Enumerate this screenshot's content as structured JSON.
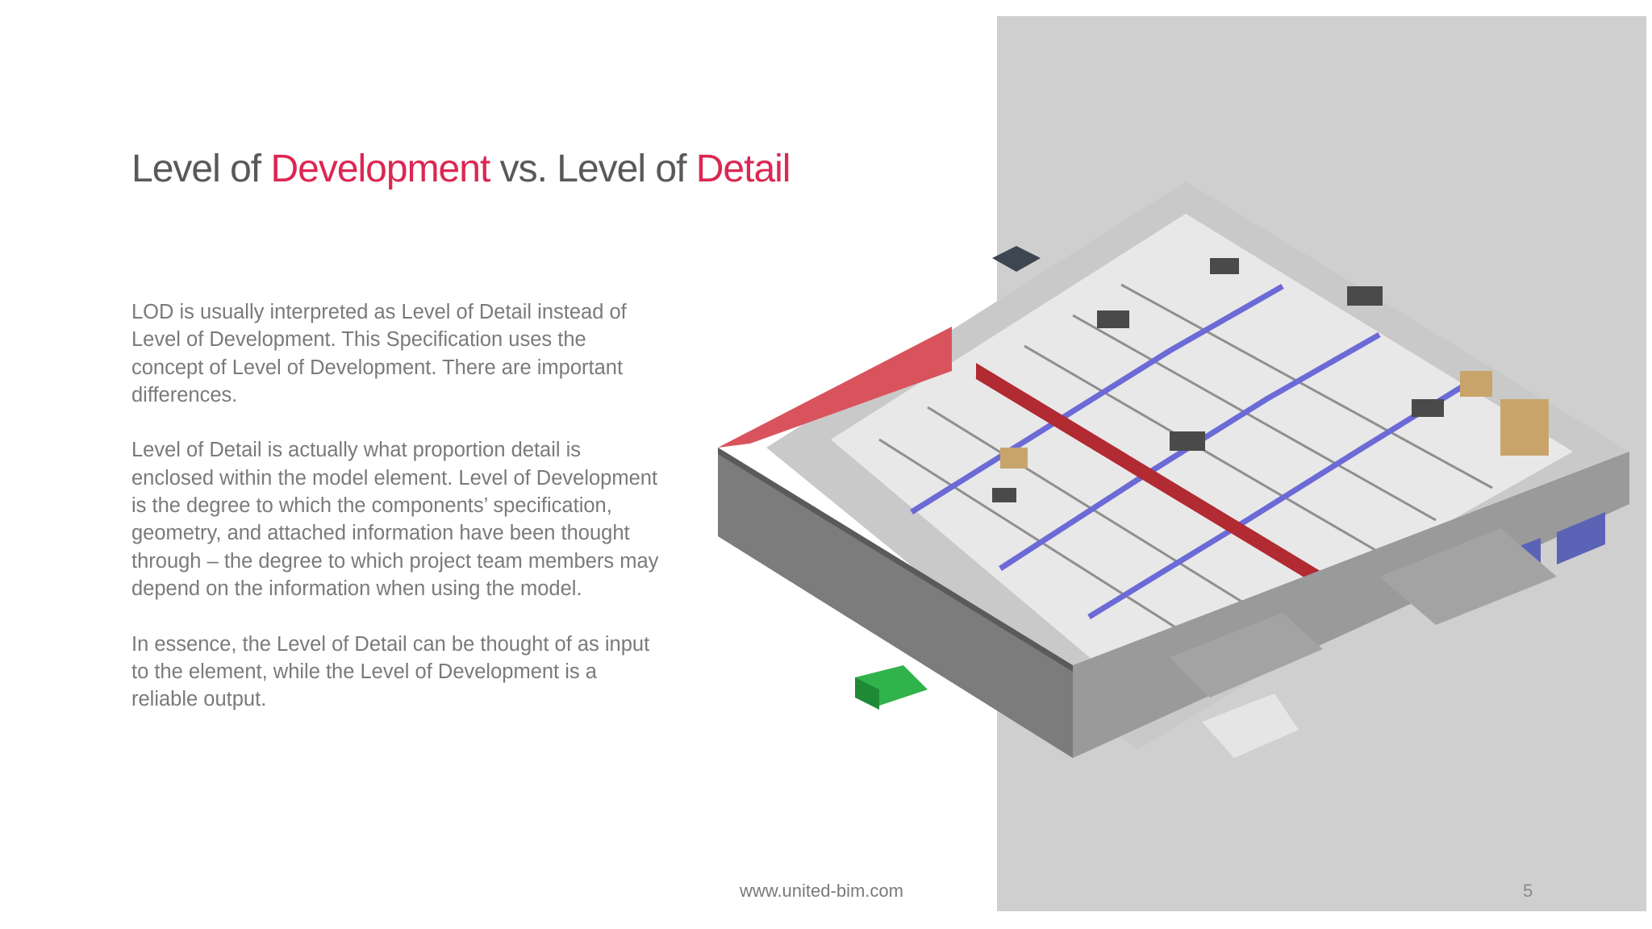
{
  "slide": {
    "title": {
      "part1": "Level of ",
      "accent1": "Development",
      "part2": " vs. Level of ",
      "accent2": "Detail"
    },
    "paragraphs": [
      "LOD is usually interpreted as Level of Detail instead of Level of Development. This Specification uses the concept of Level of Development. There are important differences.",
      "Level of Detail is actually what proportion detail is enclosed within the model element. Level of Development is the degree to which the components’ specification, geometry, and attached information have been thought through – the degree to which project team members may depend on the information when using the model.",
      "In essence, the Level of Detail can be thought of as input to the element, while the Level of Development is a reliable output."
    ],
    "footer_url": "www.united-bim.com",
    "page_number": "5"
  },
  "colors": {
    "accent": "#dc2753",
    "body_text": "#7a7a7a",
    "title_text": "#595959",
    "panel": "#d0cfd0"
  }
}
